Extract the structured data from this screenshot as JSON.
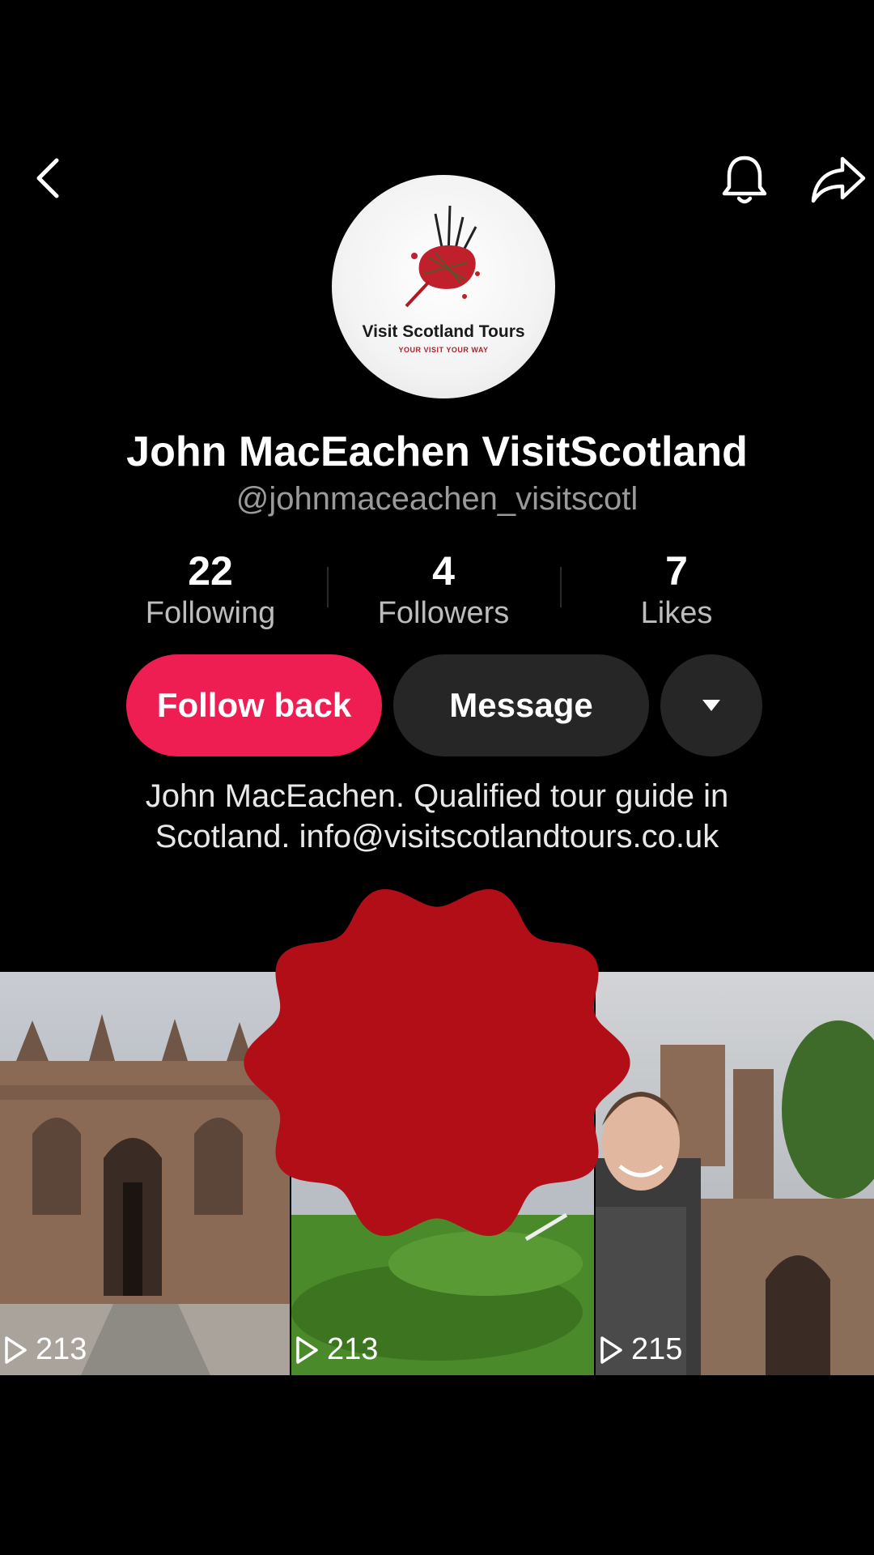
{
  "header": {
    "back_icon": "chevron-left-icon",
    "notify_icon": "bell-icon",
    "share_icon": "share-arrow-icon"
  },
  "avatar": {
    "brand": "Visit Scotland Tours",
    "tagline": "YOUR VISIT YOUR WAY"
  },
  "profile": {
    "name": "John MacEachen VisitScotland",
    "handle": "@johnmaceachen_visitscotl"
  },
  "stats": [
    {
      "value": "22",
      "label": "Following"
    },
    {
      "value": "4",
      "label": "Followers"
    },
    {
      "value": "7",
      "label": "Likes"
    }
  ],
  "actions": {
    "follow_back": "Follow back",
    "message": "Message",
    "more_icon": "caret-down-icon"
  },
  "bio": {
    "line1": "John MacEachen. Qualified tour guide in",
    "line2": "Scotland. info@visitscotlandtours.co.uk"
  },
  "videos": [
    {
      "views": "213"
    },
    {
      "views": "213"
    },
    {
      "views": "215"
    }
  ],
  "colors": {
    "accent": "#EE1D52",
    "secondary_button": "#262626",
    "badge_red": "#B20E18",
    "background": "#000000"
  }
}
